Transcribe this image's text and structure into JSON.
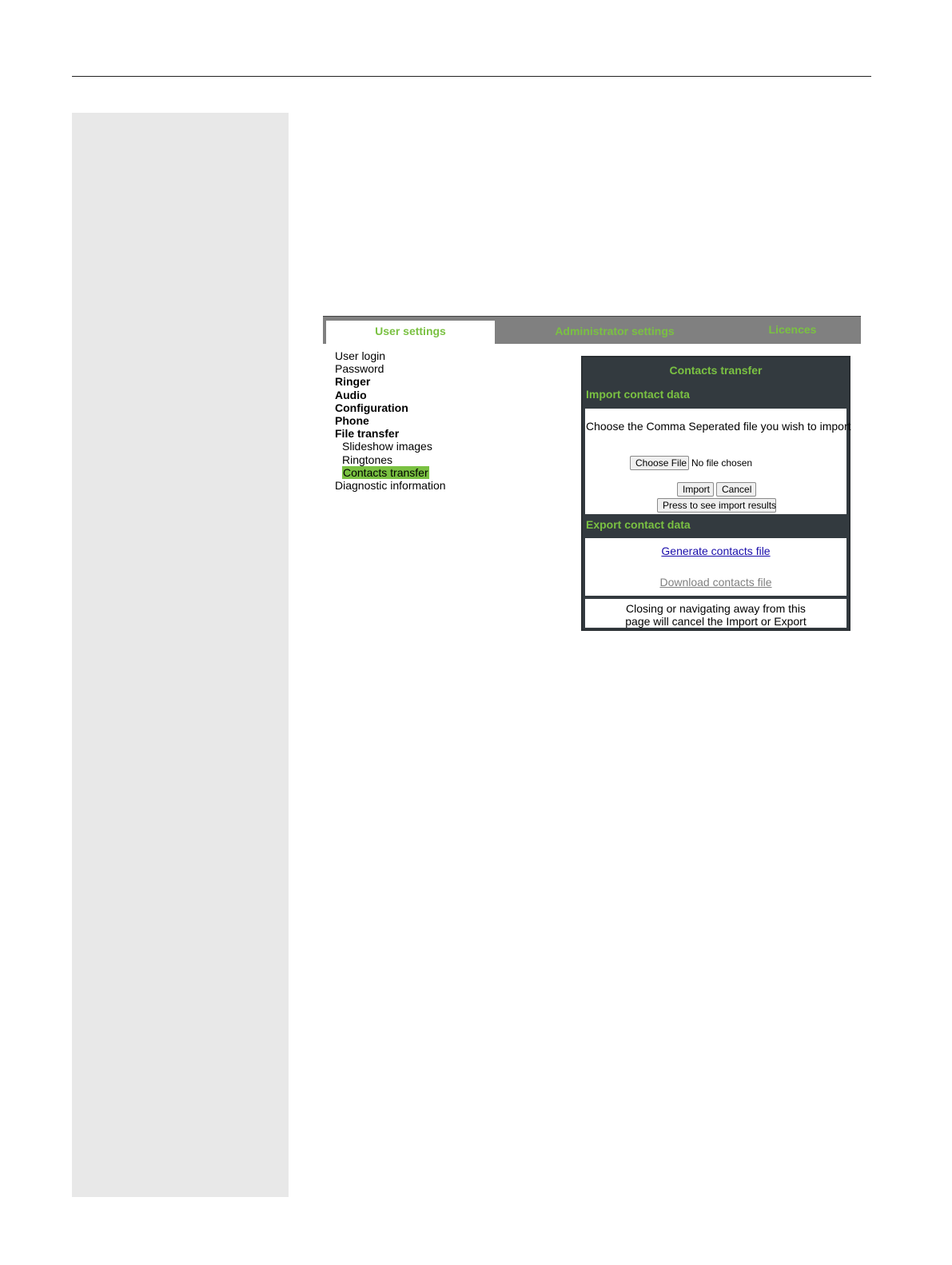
{
  "tabs": {
    "user_settings": "User settings",
    "administrator_settings": "Administrator settings",
    "licences": "Licences"
  },
  "menu": {
    "user_login": "User login",
    "password": "Password",
    "ringer": "Ringer",
    "audio": "Audio",
    "configuration": "Configuration",
    "phone": "Phone",
    "file_transfer": "File transfer",
    "slideshow_images": "Slideshow images",
    "ringtones": "Ringtones",
    "contacts_transfer": "Contacts transfer",
    "diagnostic_information": "Diagnostic information"
  },
  "panel": {
    "title": "Contacts transfer",
    "import_heading": "Import contact data",
    "import_prompt": "Choose the Comma Seperated file you wish to import",
    "choose_file": "Choose File",
    "no_file": "No file chosen",
    "import_button": "Import",
    "cancel_button": "Cancel",
    "results_button": "Press to see import results",
    "export_heading": "Export contact data",
    "generate_link": "Generate contacts file",
    "download_link": "Download contacts file",
    "notice_line1": "Closing or navigating away from this",
    "notice_line2": "page will cancel the Import or Export"
  },
  "colors": {
    "accent_green": "#7ac142",
    "panel_dark": "#333a3f",
    "tabbar_gray": "#808080",
    "side_band": "#e8e8e8"
  }
}
